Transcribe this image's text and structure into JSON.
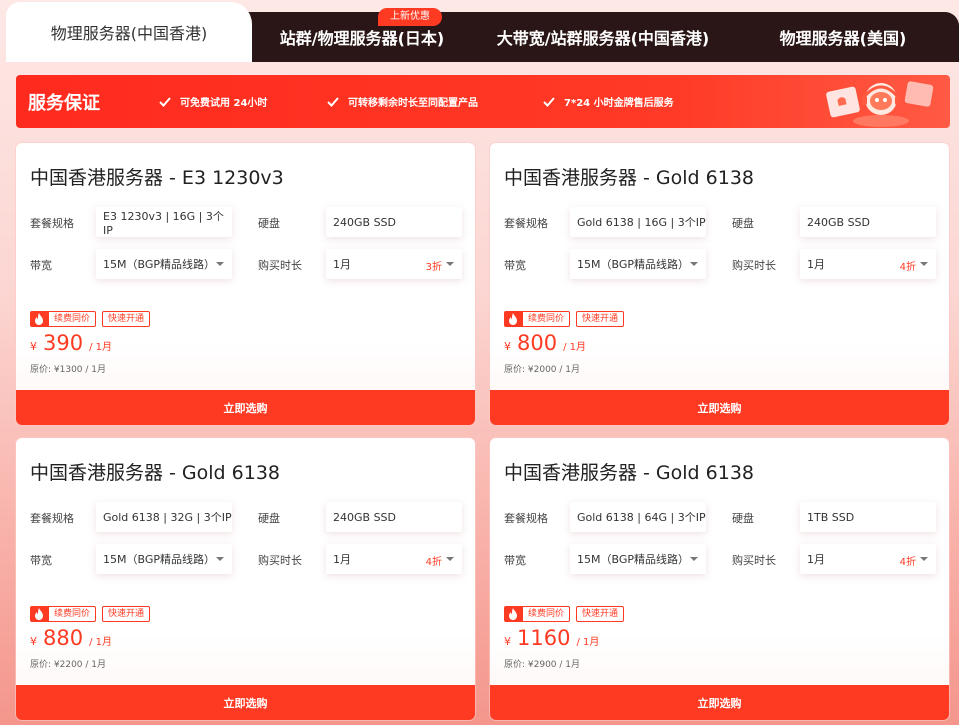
{
  "tabs": [
    {
      "label": "物理服务器(中国香港)",
      "active": true
    },
    {
      "label": "站群/物理服务器(日本)",
      "active": false
    },
    {
      "label": "大带宽/站群服务器(中国香港)",
      "active": false
    },
    {
      "label": "物理服务器(美国)",
      "active": false
    }
  ],
  "new_badge": "上新优惠",
  "banner": {
    "title": "服务保证",
    "items": [
      "可免费试用 24小时",
      "可转移剩余时长至同配置产品",
      "7*24 小时金牌售后服务"
    ]
  },
  "labels": {
    "spec": "套餐规格",
    "disk": "硬盘",
    "bandwidth": "带宽",
    "duration": "购买时长",
    "tag_renew": "续费同价",
    "tag_fast": "快速开通",
    "buy": "立即选购",
    "currency": "¥"
  },
  "cards": [
    {
      "title": "中国香港服务器 - E3 1230v3",
      "spec": "E3 1230v3 | 16G | 3个IP",
      "disk": "240GB SSD",
      "bandwidth": "15M（BGP精品线路）",
      "duration": "1月",
      "discount": "3折",
      "price": "390",
      "period": "/ 1月",
      "original": "原价: ¥1300 / 1月"
    },
    {
      "title": "中国香港服务器 - Gold 6138",
      "spec": "Gold 6138 | 16G | 3个IP",
      "disk": "240GB SSD",
      "bandwidth": "15M（BGP精品线路）",
      "duration": "1月",
      "discount": "4折",
      "price": "800",
      "period": "/ 1月",
      "original": "原价: ¥2000 / 1月"
    },
    {
      "title": "中国香港服务器 - Gold 6138",
      "spec": "Gold 6138 | 32G | 3个IP",
      "disk": "240GB SSD",
      "bandwidth": "15M（BGP精品线路）",
      "duration": "1月",
      "discount": "4折",
      "price": "880",
      "period": "/ 1月",
      "original": "原价: ¥2200 / 1月"
    },
    {
      "title": "中国香港服务器 - Gold 6138",
      "spec": "Gold 6138 | 64G | 3个IP",
      "disk": "1TB SSD",
      "bandwidth": "15M（BGP精品线路）",
      "duration": "1月",
      "discount": "4折",
      "price": "1160",
      "period": "/ 1月",
      "original": "原价: ¥2900 / 1月"
    }
  ],
  "colors": {
    "accent": "#ff3a22",
    "tab_dark": "#2a1616"
  },
  "icons": [
    "check-icon",
    "fire-icon",
    "chevron-down-icon",
    "support-mascot-icon"
  ]
}
